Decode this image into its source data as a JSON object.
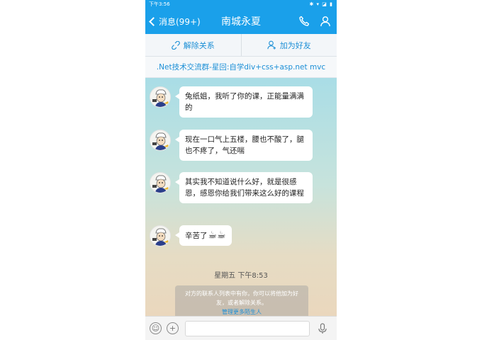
{
  "statusbar": {
    "time": "下午3:56",
    "icons": "✱ ▾ ◪ ▮"
  },
  "navbar": {
    "back_label": "消息(99+)",
    "title": "南城永夏"
  },
  "actions": {
    "remove_label": "解除关系",
    "add_label": "加为好友"
  },
  "group": {
    "label": ".Net技术交流群-星回:自学div+css+asp.net mvc"
  },
  "messages": [
    {
      "text": "兔纸姐，我听了你的课，正能量满满的"
    },
    {
      "text": "现在一口气上五楼，腰也不酸了，腿也不疼了，气还喘"
    },
    {
      "text": "其实我不知道说什么好，就是很感恩，感恩你给我们带来这么好的课程"
    },
    {
      "text": "辛苦了",
      "emoji": "☕☕"
    }
  ],
  "timestamp": "星期五 下午8:53",
  "sysnote": {
    "text": "对方的联系人列表中有你，你可以将他加为好友，或者解除关系。",
    "link": "管理更多陌生人"
  },
  "inputbar": {
    "emoji_glyph": "☺",
    "plus_glyph": "+"
  },
  "colors": {
    "brand": "#1aa0ea",
    "link": "#1c8fd6"
  }
}
